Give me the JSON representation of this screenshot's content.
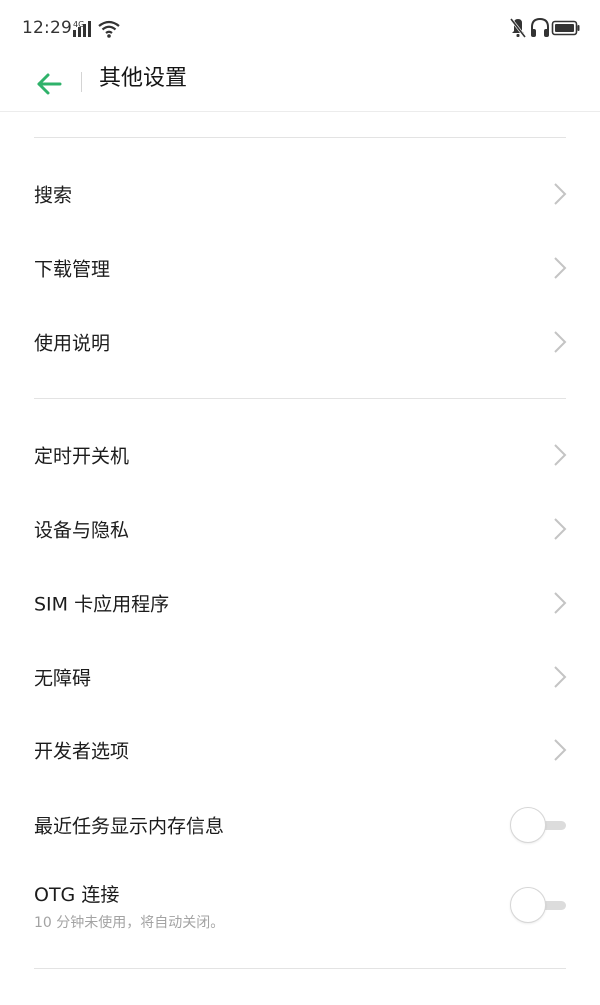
{
  "status_bar": {
    "time": "12:29",
    "network": "4G",
    "icons": [
      "signal-icon",
      "wifi-icon",
      "mute-icon",
      "headphones-icon",
      "battery-icon"
    ]
  },
  "header": {
    "title": "其他设置",
    "back_icon": "back-arrow-icon",
    "accent_color": "#2fb26a"
  },
  "sections": [
    {
      "items": [
        {
          "label": "搜索"
        },
        {
          "label": "下载管理"
        },
        {
          "label": "使用说明"
        }
      ]
    },
    {
      "items": [
        {
          "label": "定时开关机"
        },
        {
          "label": "设备与隐私"
        },
        {
          "label": "SIM 卡应用程序"
        },
        {
          "label": "无障碍"
        },
        {
          "label": "开发者选项"
        }
      ]
    }
  ],
  "toggles": [
    {
      "label": "最近任务显示内存信息",
      "on": false
    },
    {
      "label": "OTG 连接",
      "sublabel": "10 分钟未使用，将自动关闭。",
      "on": false
    }
  ]
}
